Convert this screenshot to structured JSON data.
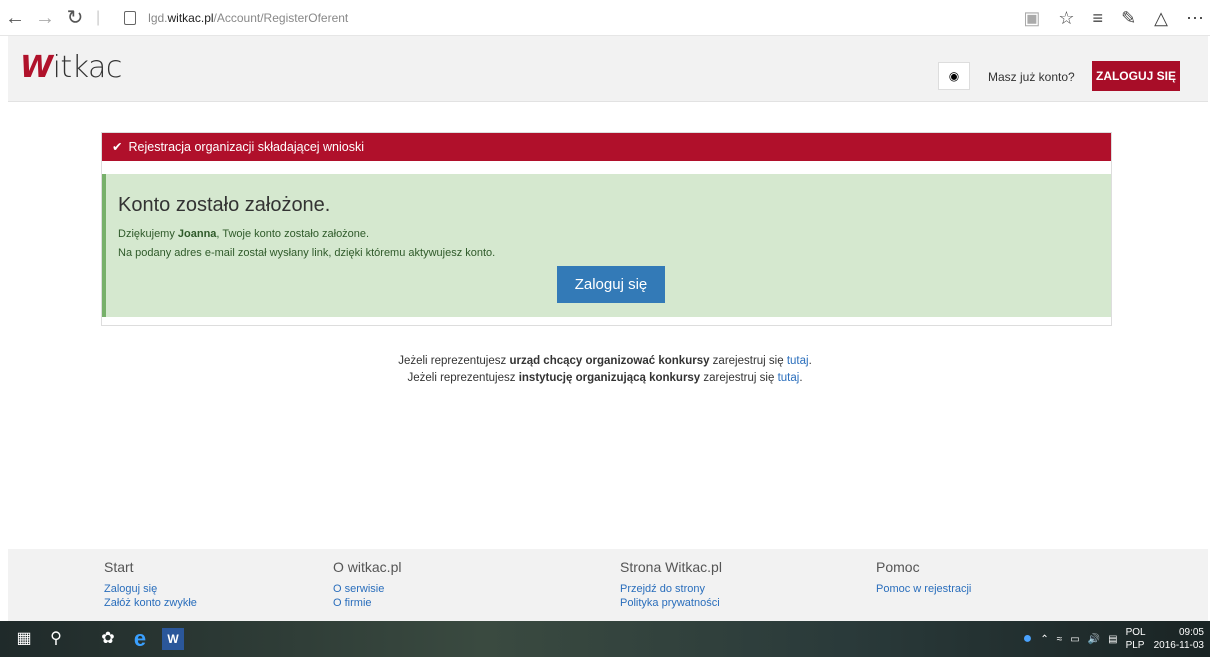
{
  "browser": {
    "url_prefix": "lgd.",
    "url_host": "witkac.pl",
    "url_path": "/Account/RegisterOferent"
  },
  "header": {
    "logo_w": "W",
    "logo_rest": "itkac",
    "have_account": "Masz już konto?",
    "login_button": "ZALOGUJ SIĘ"
  },
  "panel": {
    "title": "Rejestracja organizacji składającej wnioski",
    "success_title": "Konto zostało założone.",
    "thanks_prefix": "Dziękujemy ",
    "user_name": "Joanna",
    "thanks_suffix": ", Twoje konto zostało założone.",
    "email_note": "Na podany adres e-mail został wysłany link, dzięki któremu aktywujesz konto.",
    "login_button": "Zaloguj się"
  },
  "info": {
    "line1_prefix": "Jeżeli reprezentujesz ",
    "line1_bold": "urząd chcący organizować konkursy",
    "line1_mid": " zarejestruj się ",
    "line1_link": "tutaj",
    "line1_end": ".",
    "line2_prefix": "Jeżeli reprezentujesz ",
    "line2_bold": "instytucję organizującą konkursy",
    "line2_mid": " zarejestruj się ",
    "line2_link": "tutaj",
    "line2_end": "."
  },
  "footer": {
    "columns": [
      {
        "heading": "Start",
        "links": [
          "Zaloguj się",
          "Załóż konto zwykłe"
        ]
      },
      {
        "heading": "O witkac.pl",
        "links": [
          "O serwisie",
          "O firmie"
        ]
      },
      {
        "heading": "Strona Witkac.pl",
        "links": [
          "Przejdź do strony",
          "Polityka prywatności"
        ]
      },
      {
        "heading": "Pomoc",
        "links": [
          "Pomoc w rejestracji"
        ]
      }
    ]
  },
  "taskbar": {
    "lang1": "POL",
    "lang2": "PLP",
    "time": "09:05",
    "date": "2016-11-03"
  }
}
